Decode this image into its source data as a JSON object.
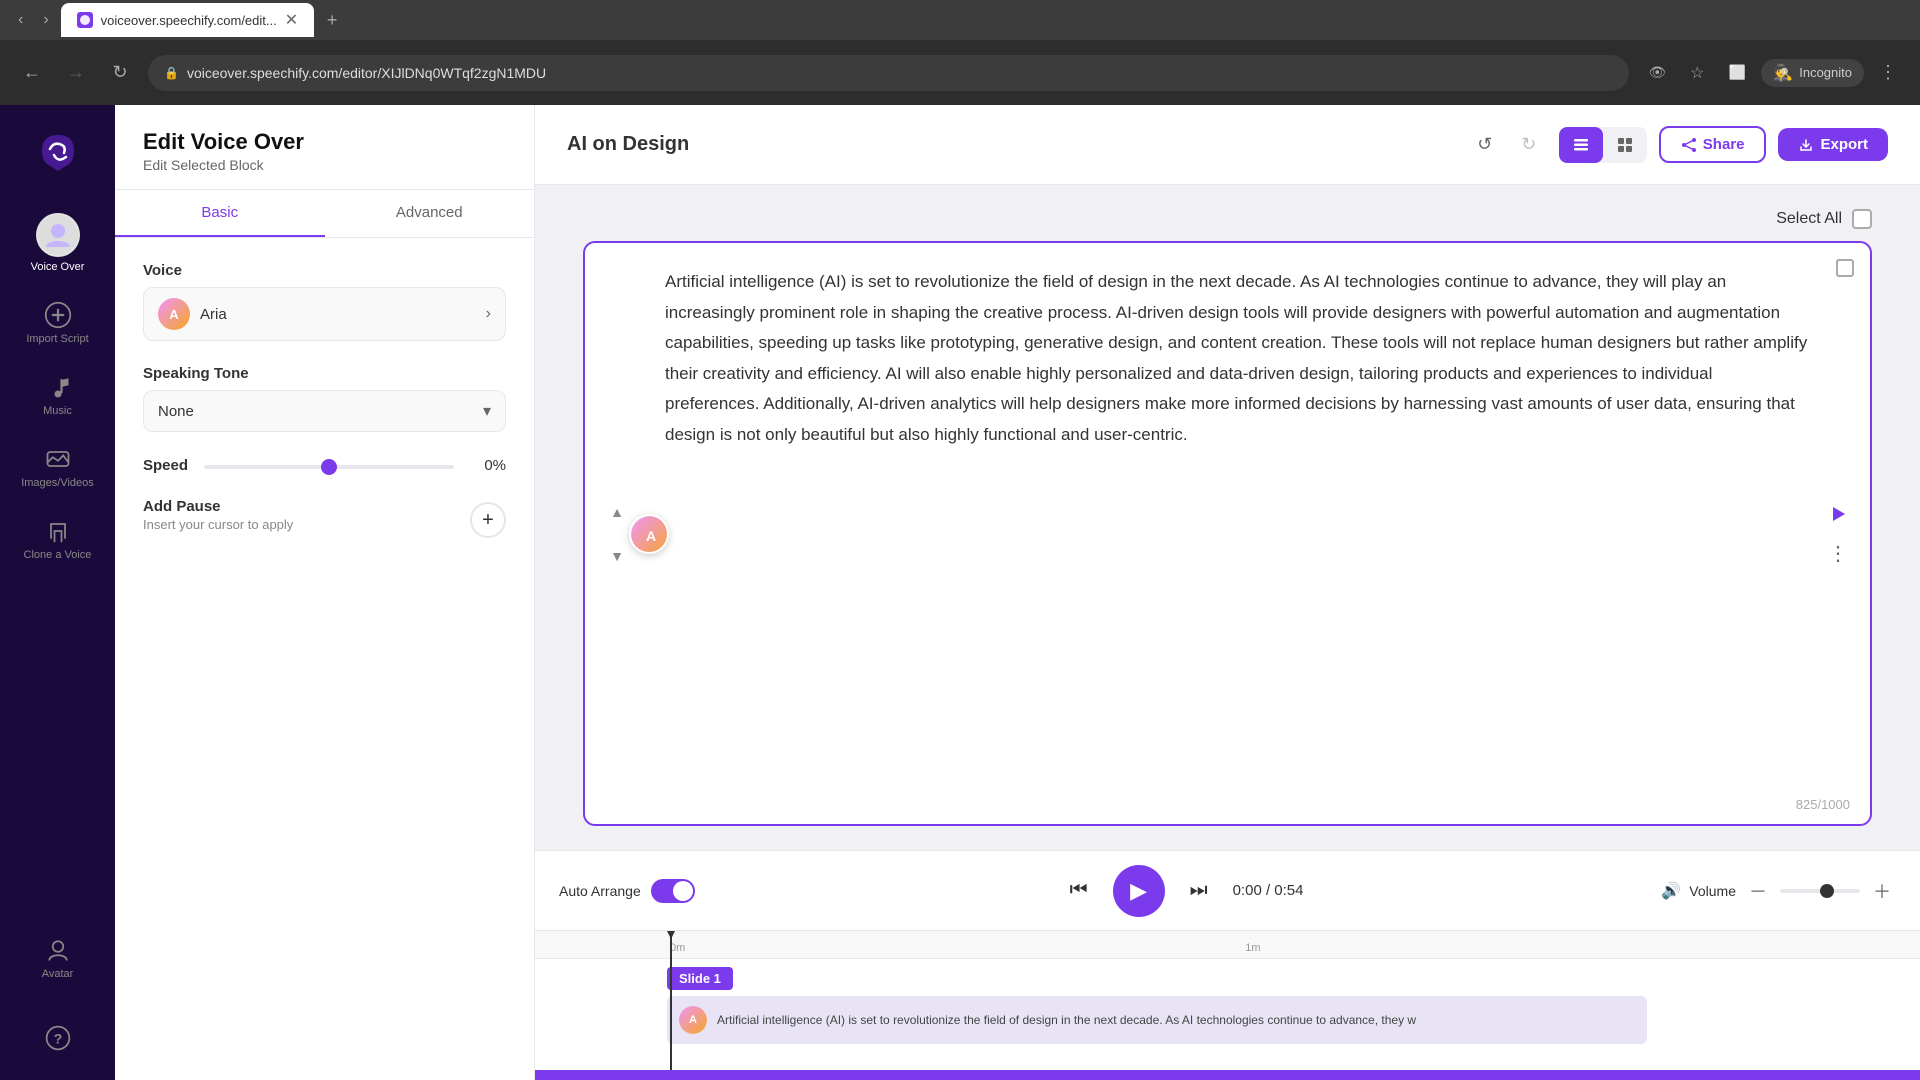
{
  "browser": {
    "tab_title": "voiceover.speechify.com/edit...",
    "tab_favicon_bg": "#7c3aed",
    "address_url": "voiceover.speechify.com/editor/XIJlDNq0WTqf2zgN1MDU",
    "incognito_label": "Incognito"
  },
  "panel": {
    "title": "Edit Voice Over",
    "subtitle": "Edit Selected Block",
    "tabs": [
      {
        "id": "basic",
        "label": "Basic"
      },
      {
        "id": "advanced",
        "label": "Advanced"
      }
    ],
    "active_tab": "basic",
    "voice_label": "Voice",
    "voice_name": "Aria",
    "speaking_tone_label": "Speaking Tone",
    "speaking_tone_value": "None",
    "speed_label": "Speed",
    "speed_value": "0%",
    "speed_percent": 50,
    "add_pause_title": "Add Pause",
    "add_pause_desc": "Insert your cursor to apply"
  },
  "header": {
    "project_title": "AI on Design",
    "undo_label": "Undo",
    "redo_label": "Redo",
    "share_label": "Share",
    "export_label": "Export"
  },
  "content": {
    "select_all_label": "Select All",
    "text_block": "Artificial intelligence (AI) is set to revolutionize the field of design in the next decade. As AI technologies continue to advance, they will play an increasingly prominent role in shaping the creative process. AI-driven design tools will provide designers with powerful automation and augmentation capabilities, speeding up tasks like prototyping, generative design, and content creation. These tools will not replace human designers but rather amplify their creativity and efficiency. AI will also enable highly personalized and data-driven design, tailoring products and experiences to individual preferences. Additionally, AI-driven analytics will help designers make more informed decisions by harnessing vast amounts of user data, ensuring that design is not only beautiful but also highly functional and user-centric.",
    "char_count": "825/1000"
  },
  "playback": {
    "auto_arrange_label": "Auto Arrange",
    "time_current": "0:00",
    "time_total": "0:54",
    "time_display": "0:00 / 0:54",
    "volume_label": "Volume"
  },
  "timeline": {
    "start_label": "0m",
    "end_label": "1m",
    "slide_label": "Slide 1",
    "track_text": "Artificial intelligence (AI) is set to revolutionize the field of design in the next decade. As AI technologies continue to advance, they w"
  },
  "sidebar": {
    "items": [
      {
        "id": "voice-over",
        "label": "Voice Over"
      },
      {
        "id": "import-script",
        "label": "Import Script"
      },
      {
        "id": "music",
        "label": "Music"
      },
      {
        "id": "images-videos",
        "label": "Images/Videos"
      },
      {
        "id": "clone-voice",
        "label": "Clone a Voice"
      },
      {
        "id": "avatar",
        "label": "Avatar"
      },
      {
        "id": "help",
        "label": ""
      }
    ]
  }
}
